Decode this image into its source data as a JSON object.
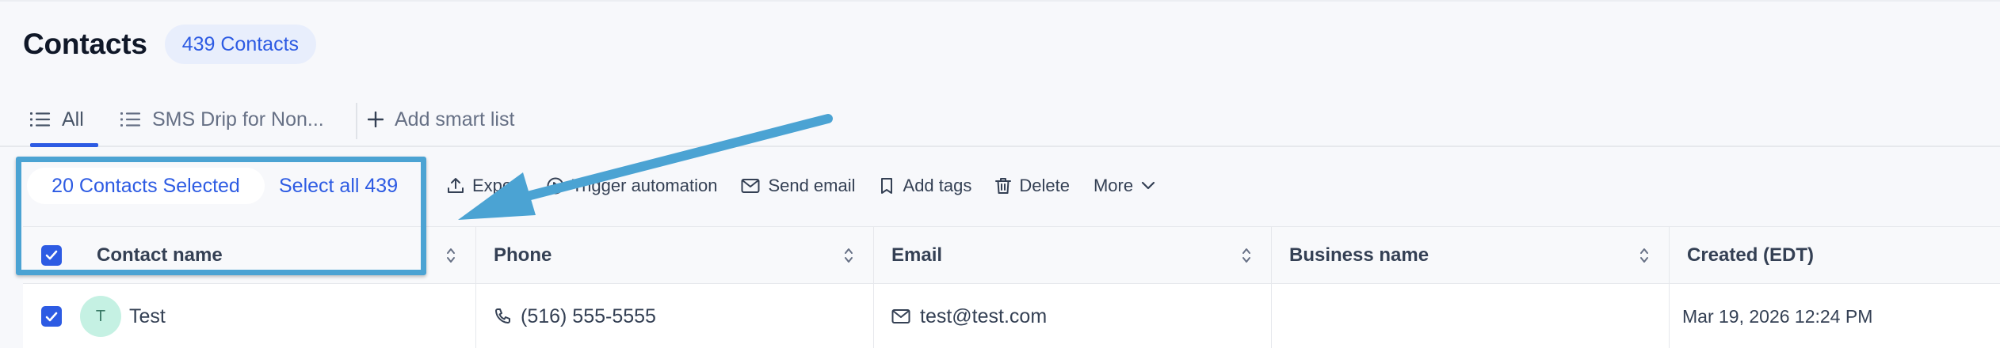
{
  "header": {
    "title": "Contacts",
    "count_badge": "439 Contacts"
  },
  "tabs": [
    {
      "label": "All",
      "active": true,
      "icon": "list-icon"
    },
    {
      "label": "SMS Drip for Non...",
      "active": false,
      "icon": "list-icon"
    },
    {
      "label": "Add smart list",
      "icon": "plus-icon"
    }
  ],
  "selection": {
    "selected_label": "20 Contacts Selected",
    "select_all_label": "Select all 439"
  },
  "actions": [
    {
      "label": "Export",
      "icon": "upload-icon"
    },
    {
      "label": "Trigger automation",
      "icon": "play-circle-icon"
    },
    {
      "label": "Send email",
      "icon": "mail-icon"
    },
    {
      "label": "Add tags",
      "icon": "tag-icon"
    },
    {
      "label": "Delete",
      "icon": "trash-icon"
    },
    {
      "label": "More",
      "icon": "chevron-down-icon"
    }
  ],
  "table": {
    "columns": [
      "Contact name",
      "Phone",
      "Email",
      "Business name",
      "Created (EDT)"
    ],
    "rows": [
      {
        "checked": true,
        "avatar_initial": "T",
        "name": "Test",
        "phone": "(516) 555-5555",
        "email": "test@test.com",
        "business": "",
        "created": "Mar 19, 2026 12:24 PM"
      }
    ]
  },
  "colors": {
    "accent": "#2d5be3",
    "annotation": "#4ba3d3",
    "avatar_bg": "#c5f1e3"
  }
}
